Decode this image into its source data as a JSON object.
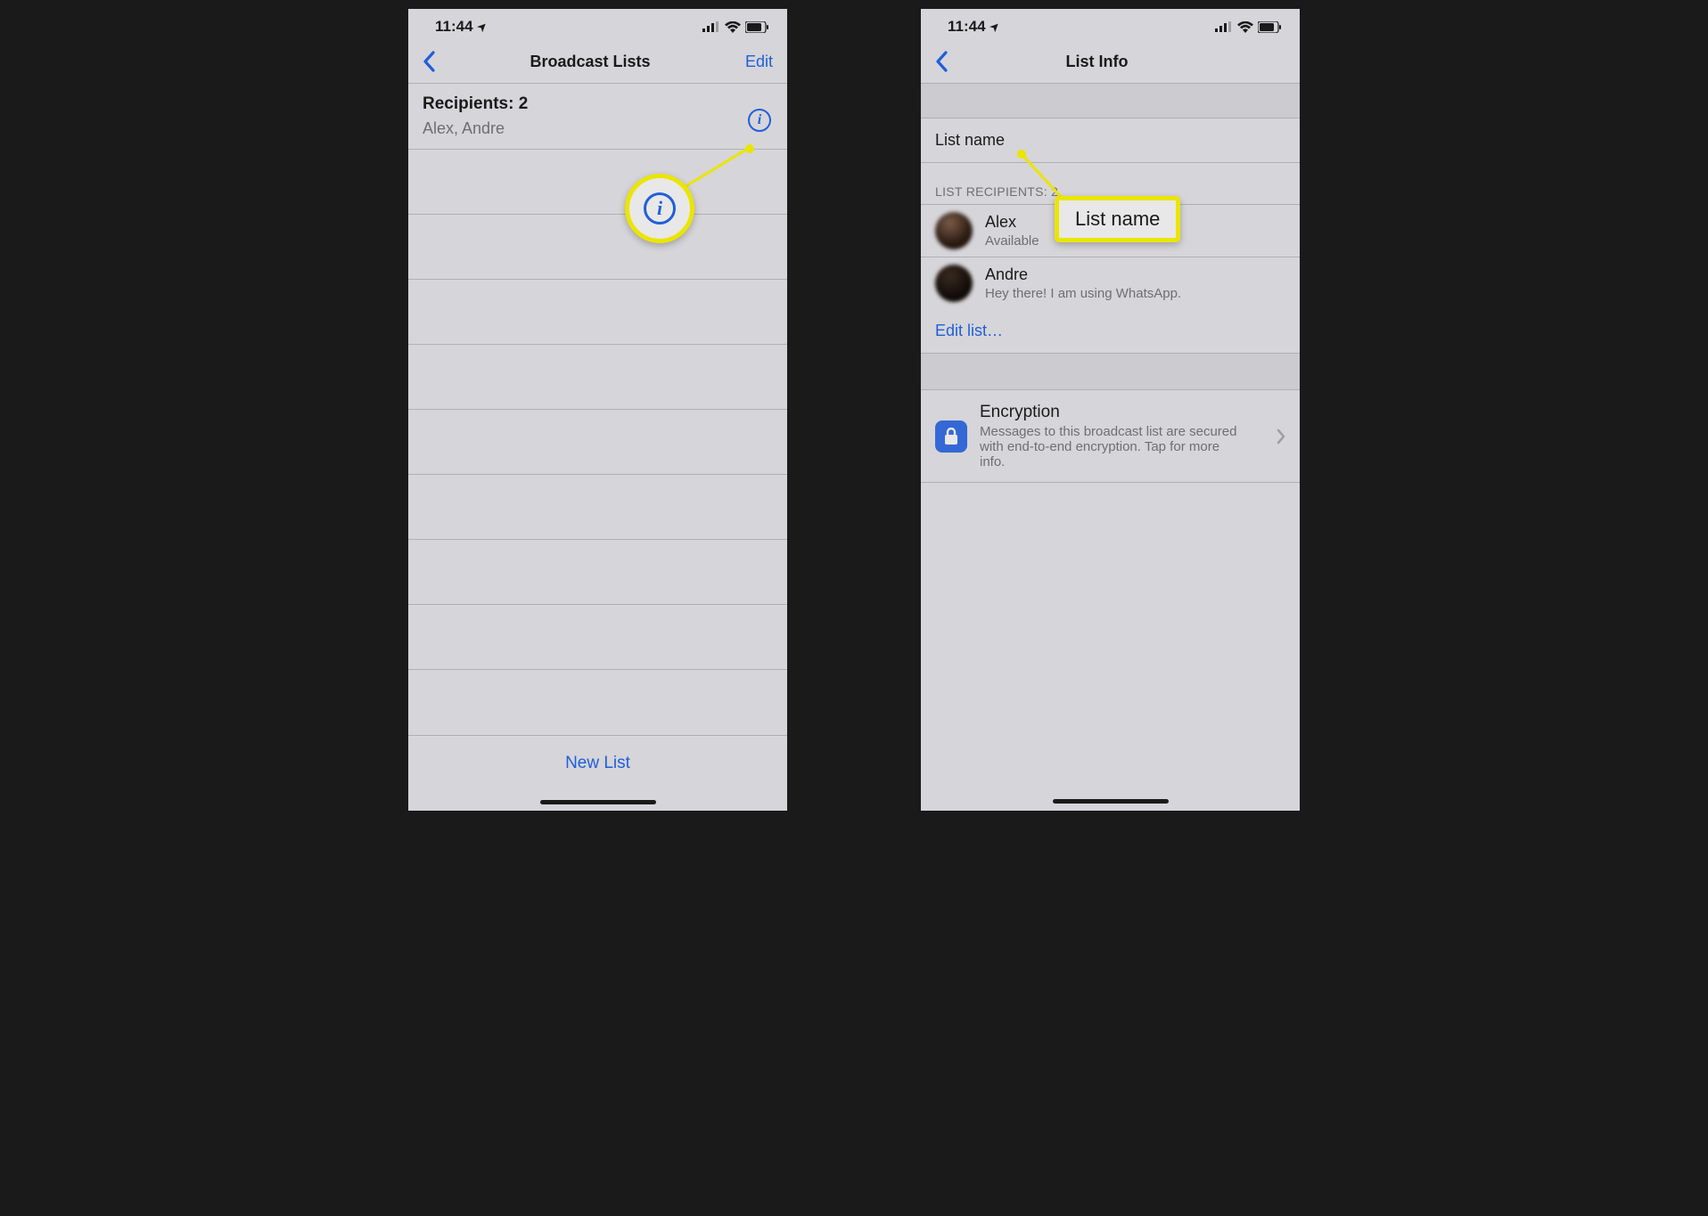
{
  "status": {
    "time": "11:44",
    "location_arrow": "➤"
  },
  "screen1": {
    "title": "Broadcast Lists",
    "edit": "Edit",
    "recipients_label": "Recipients: 2",
    "recipients_names": "Alex, Andre",
    "new_list": "New List"
  },
  "screen2": {
    "title": "List Info",
    "list_name_field": "List name",
    "recipients_header": "LIST RECIPIENTS: 2",
    "contacts": [
      {
        "name": "Alex",
        "status": "Available"
      },
      {
        "name": "Andre",
        "status": "Hey there! I am using WhatsApp."
      }
    ],
    "edit_list": "Edit list…",
    "encryption_title": "Encryption",
    "encryption_desc": "Messages to this broadcast list are secured with end-to-end encryption. Tap for more info.",
    "callout_label": "List name"
  }
}
